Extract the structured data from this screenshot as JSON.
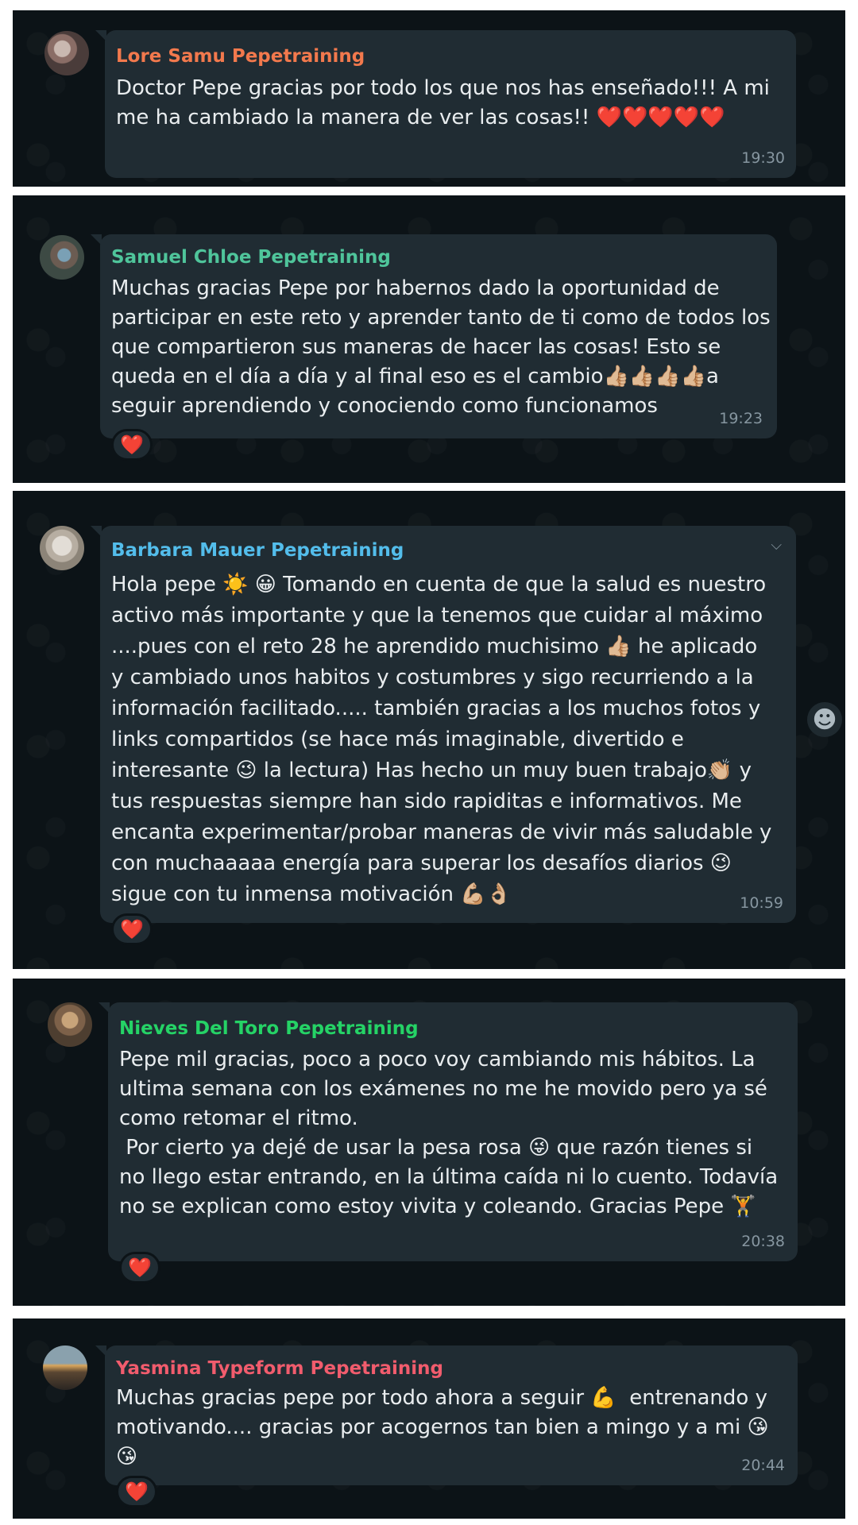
{
  "messages": [
    {
      "sender": "Lore Samu Pepetraining",
      "sender_color": "#f2794d",
      "lines": [
        "Doctor Pepe gracias por todo los que nos has enseñado!!! A mi",
        "me ha cambiado la manera de ver las cosas!! ❤️❤️❤️❤️❤️"
      ],
      "time": "19:30",
      "reaction": ""
    },
    {
      "sender": "Samuel Chloe Pepetraining",
      "sender_color": "#4fc59b",
      "lines": [
        "Muchas gracias Pepe por habernos dado la oportunidad de",
        "participar en este reto y aprender tanto de ti como de todos los",
        "que compartieron sus maneras de hacer las cosas! Esto se",
        "queda en el día a día y al final eso es el cambio👍🏼👍🏼👍🏼👍🏼a",
        "seguir aprendiendo y conociendo como funcionamos"
      ],
      "time": "19:23",
      "reaction": "❤️"
    },
    {
      "sender": "Barbara Mauer Pepetraining",
      "sender_color": "#53bdeb",
      "lines": [
        "Hola pepe ☀️ 😀 Tomando en cuenta de que la salud es nuestro",
        "activo más importante y que la tenemos que cuidar al máximo",
        "....pues con el reto 28 he aprendido muchisimo 👍🏼 he aplicado",
        "y cambiado unos habitos y costumbres y sigo recurriendo a la",
        "información facilitado..... también gracias a los muchos fotos y",
        "links compartidos (se hace más imaginable, divertido e",
        "interesante 😉 la lectura) Has hecho un muy buen trabajo👏🏼 y",
        "tus respuestas siempre han sido rapiditas e informativos. Me",
        "encanta experimentar/probar maneras de vivir más saludable y",
        "con muchaaaaa energía para superar los desafíos diarios 😉",
        "sigue con tu inmensa motivación 💪🏼👌🏼"
      ],
      "time": "10:59",
      "reaction": "❤️"
    },
    {
      "sender": "Nieves Del Toro Pepetraining",
      "sender_color": "#25d366",
      "lines": [
        "Pepe mil gracias, poco a poco voy cambiando mis hábitos. La",
        "ultima semana con los exámenes no me he movido pero ya sé",
        "como retomar el ritmo.",
        " Por cierto ya dejé de usar la pesa rosa 😜 que razón tienes si",
        "no llego estar entrando, en la última caída ni lo cuento. Todavía",
        "no se explican como estoy vivita y coleando. Gracias Pepe 🏋️"
      ],
      "time": "20:38",
      "reaction": "❤️"
    },
    {
      "sender": "Yasmina Typeform Pepetraining",
      "sender_color": "#f15c6d",
      "lines": [
        "Muchas gracias pepe por todo ahora a seguir 💪  entrenando y",
        "motivando.... gracias por acogernos tan bien a mingo y a mi 😘",
        "😘"
      ],
      "time": "20:44",
      "reaction": "❤️"
    }
  ],
  "icons": {
    "chevron": "⌵",
    "emoji_button": "☻"
  }
}
